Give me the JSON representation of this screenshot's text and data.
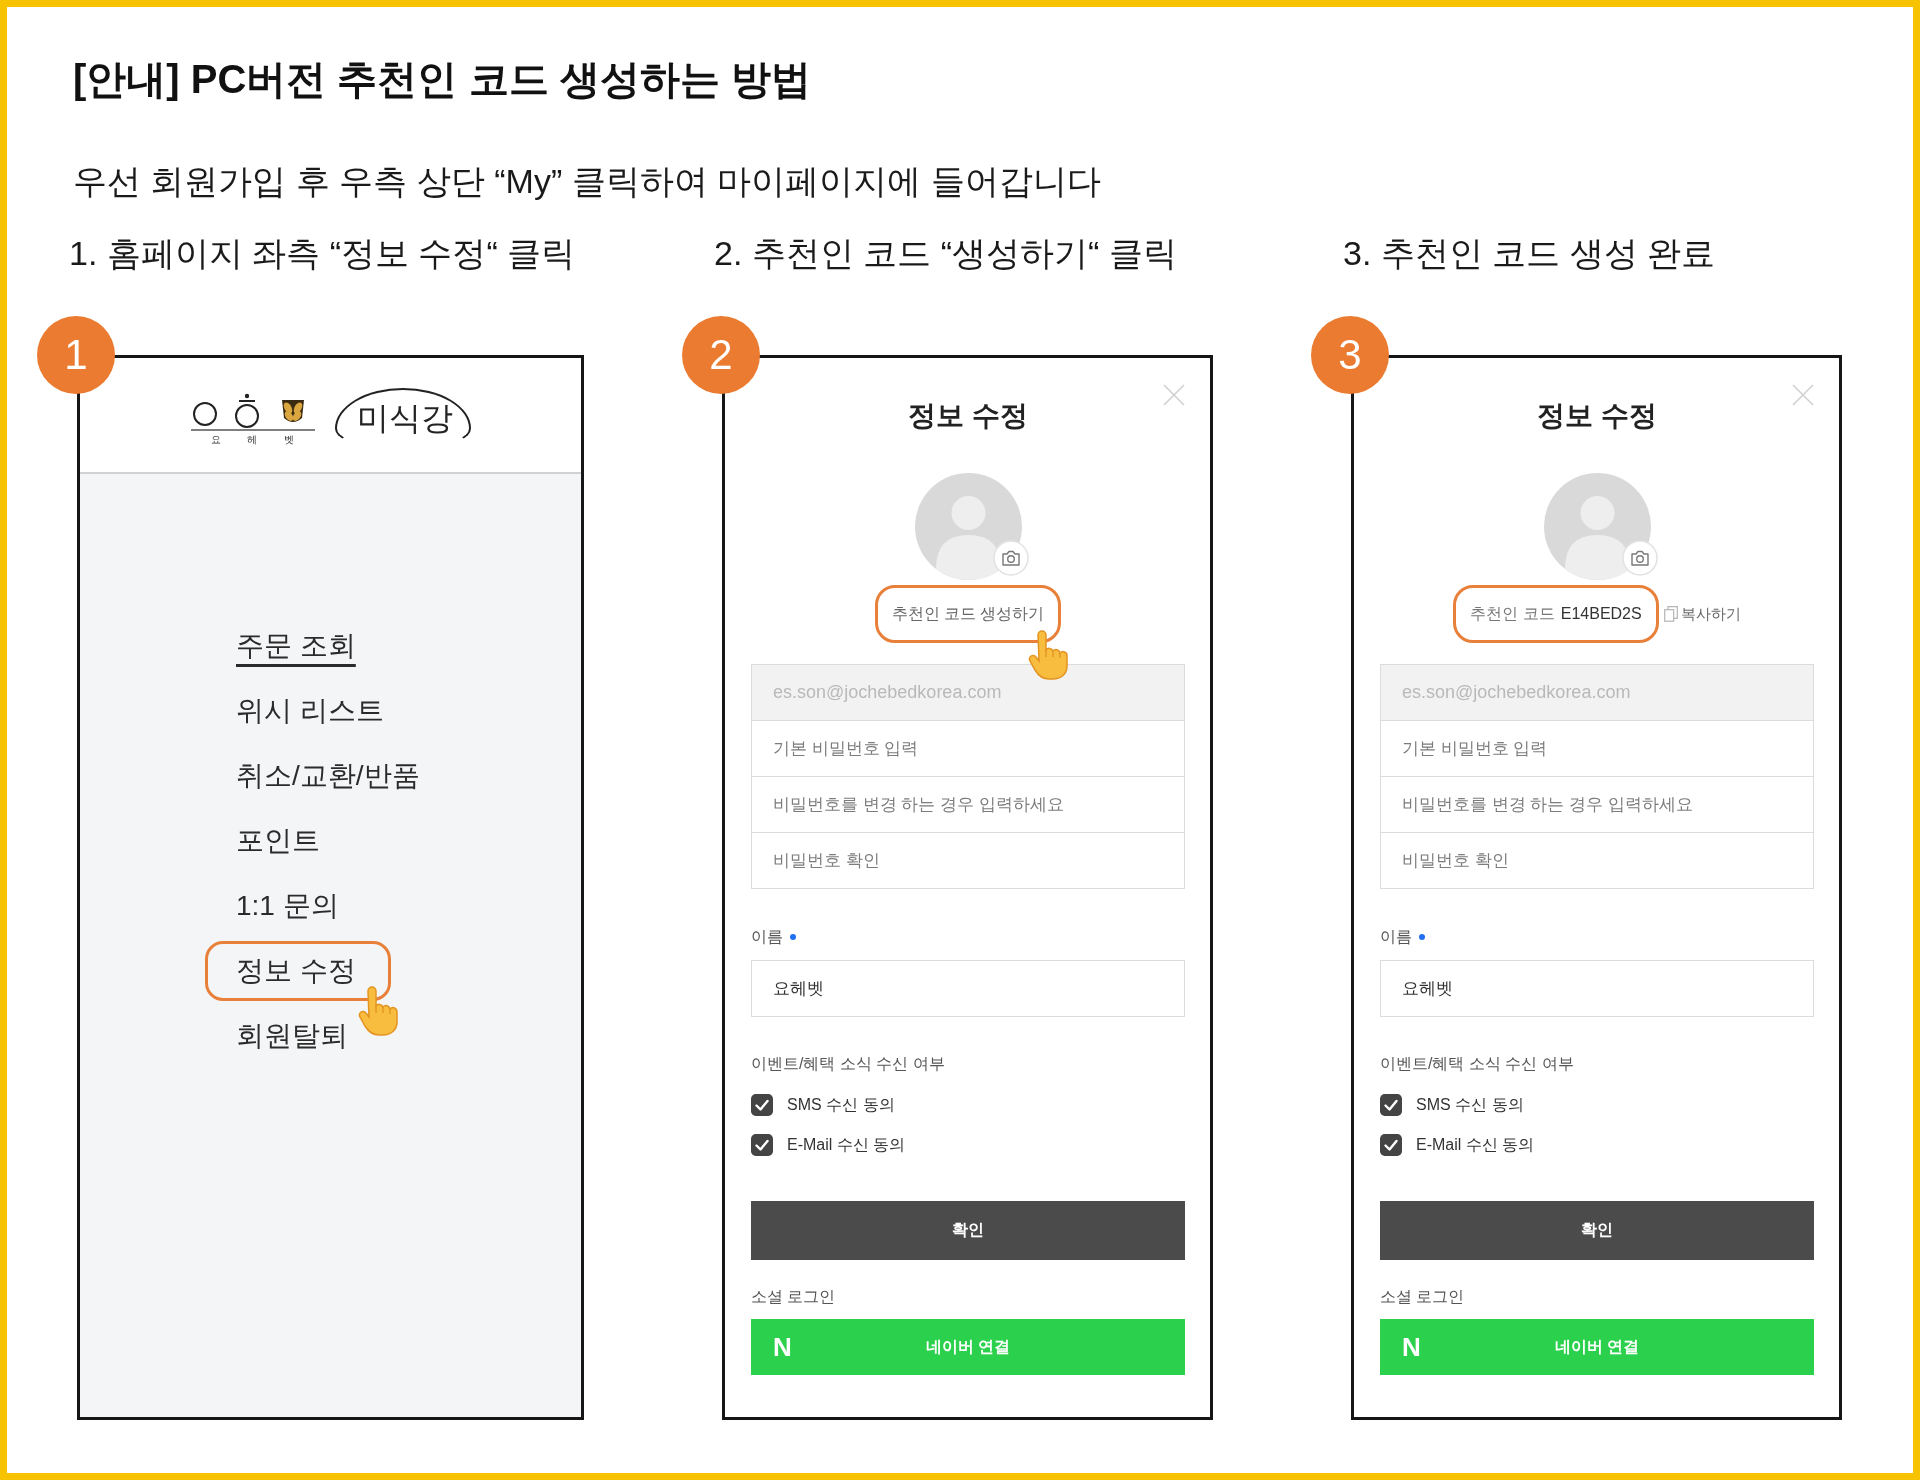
{
  "title": "[안내] PC버전 추천인 코드 생성하는 방법",
  "intro": "우선 회원가입 후 우측 상단 “My” 클릭하여 마이페이지에 들어갑니다",
  "steps": [
    {
      "number": "1",
      "caption": "1. 홈페이지 좌측 “정보 수정“ 클릭",
      "screen": {
        "kind": "menu",
        "logo": {
          "tagline": "요 헤 벳",
          "wordmark": "미식강"
        },
        "menu": [
          {
            "label": "주문 조회",
            "selected": true,
            "highlighted": false
          },
          {
            "label": "위시 리스트",
            "selected": false,
            "highlighted": false
          },
          {
            "label": "취소/교환/반품",
            "selected": false,
            "highlighted": false
          },
          {
            "label": "포인트",
            "selected": false,
            "highlighted": false
          },
          {
            "label": "1:1 문의",
            "selected": false,
            "highlighted": false
          },
          {
            "label": "정보 수정",
            "selected": false,
            "highlighted": true
          },
          {
            "label": "회원탈퇴",
            "selected": false,
            "highlighted": false
          }
        ]
      }
    },
    {
      "number": "2",
      "caption": "2. 추천인 코드 “생성하기“ 클릭",
      "screen": {
        "kind": "form",
        "title": "정보 수정",
        "referral": {
          "kind": "link",
          "label": "추천인 코드 생성하기",
          "highlighted": true,
          "pointer": true
        },
        "account_fields": [
          {
            "value": "es.son@jochebedkorea.com",
            "disabled": true
          },
          {
            "placeholder": "기본 비밀번호 입력",
            "disabled": false
          },
          {
            "placeholder": "비밀번호를 변경 하는 경우 입력하세요",
            "disabled": false
          },
          {
            "placeholder": "비밀번호 확인",
            "disabled": false
          }
        ],
        "name_label": "이름",
        "name_required": true,
        "name_value": "요헤벳",
        "consent_title": "이벤트/혜택 소식 수신 여부",
        "consents": [
          {
            "label": "SMS 수신 동의",
            "checked": true
          },
          {
            "label": "E-Mail 수신 동의",
            "checked": true
          }
        ],
        "submit": "확인",
        "social_title": "소셜 로그인",
        "naver": {
          "logo": "N",
          "label": "네이버 연결"
        }
      }
    },
    {
      "number": "3",
      "caption": "3. 추천인 코드 생성 완료",
      "screen": {
        "kind": "form",
        "title": "정보 수정",
        "referral": {
          "kind": "code",
          "label": "추천인 코드",
          "code": "E14BED2S",
          "copy_label": "복사하기",
          "highlighted": true,
          "pointer": false
        },
        "account_fields": [
          {
            "value": "es.son@jochebedkorea.com",
            "disabled": true
          },
          {
            "placeholder": "기본 비밀번호 입력",
            "disabled": false
          },
          {
            "placeholder": "비밀번호를 변경 하는 경우 입력하세요",
            "disabled": false
          },
          {
            "placeholder": "비밀번호 확인",
            "disabled": false
          }
        ],
        "name_label": "이름",
        "name_required": true,
        "name_value": "요헤벳",
        "consent_title": "이벤트/혜택 소식 수신 여부",
        "consents": [
          {
            "label": "SMS 수신 동의",
            "checked": true
          },
          {
            "label": "E-Mail 수신 동의",
            "checked": true
          }
        ],
        "submit": "확인",
        "social_title": "소셜 로그인",
        "naver": {
          "logo": "N",
          "label": "네이버 연결"
        }
      }
    }
  ]
}
